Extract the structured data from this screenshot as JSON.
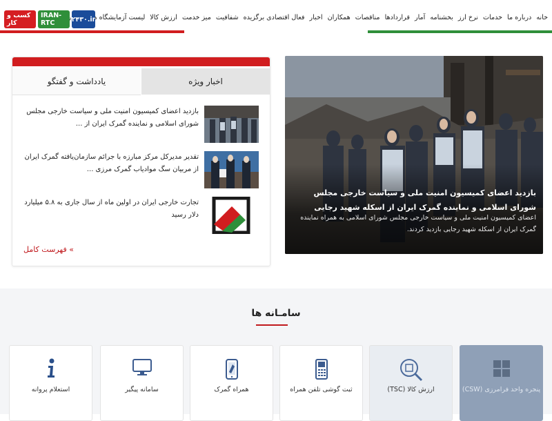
{
  "nav": {
    "links": [
      "خانه",
      "درباره ما",
      "خدمات",
      "نرخ ارز",
      "بخشنامه",
      "آمار",
      "قراردادها",
      "مناقصات",
      "همکاران",
      "اخبار",
      "فعال اقتصادی برگزیده",
      "شفافیت",
      "میز خدمت",
      "ارزش کالا",
      "لیست آزمایشگاه های همکار گمرک"
    ],
    "badges": {
      "business": "کسب و کار",
      "iran_rtc": "IRAN-RTC",
      "phone": "۲۴۳۰.ir"
    }
  },
  "colors": {
    "accent_red": "#d11d1f",
    "flag_green": "#2f8f3a",
    "flag_red": "#d11d1f",
    "badge_blue": "#1b4c9a",
    "csw_card": "#8fa0b7"
  },
  "hero": {
    "title": "بازدید اعضای کمیسیون امنیت ملی و سیاست خارجی مجلس شورای اسلامی و نماینده گمرک ایران از اسکله شهید رجایی",
    "summary": "اعضای کمیسیون امنیت ملی و سیاست خارجی مجلس شورای اسلامی به همراه نماینده گمرک ایران از اسکله شهید رجایی بازدید کردند."
  },
  "news": {
    "tabs": {
      "active": "اخبار ویژه",
      "inactive": "یادداشت و گفتگو"
    },
    "items": [
      {
        "text": "بازدید اعضای کمیسیون امنیت ملی و سیاست خارجی مجلس شورای اسلامی و نماینده گمرک ایران از ..."
      },
      {
        "text": "تقدیر مدیرکل مرکز مبارزه با جرائم سازمان‌یافته گمرک ایران از مربیان سگ موادیاب گمرک مرزی ..."
      },
      {
        "text": "تجارت خارجی ایران در اولین ماه از سال جاری به ۵.۸ میلیارد دلار رسید"
      }
    ],
    "more": "» فهرست کامل"
  },
  "systems": {
    "title": "سامـانه ها",
    "cards": [
      {
        "label": "پنجره واحد فرامرزی (CSW)",
        "icon": "grid-icon"
      },
      {
        "label": "ارزش کالا (TSC)",
        "icon": "magnifier-icon"
      },
      {
        "label": "ثبت گوشی تلفن همراه",
        "icon": "feature-phone-icon"
      },
      {
        "label": "همراه گمرک",
        "icon": "smartphone-icon"
      },
      {
        "label": "سامانه پیگیر",
        "icon": "monitor-icon"
      },
      {
        "label": "استعلام پروانه",
        "icon": "info-icon"
      }
    ]
  }
}
